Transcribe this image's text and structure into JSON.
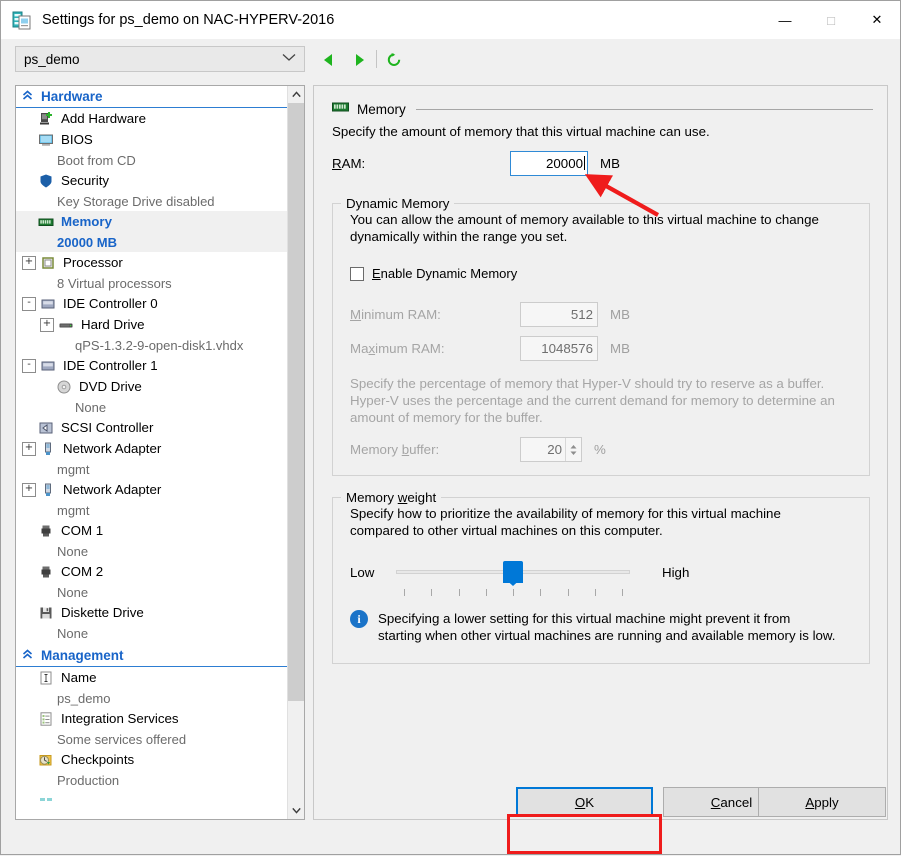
{
  "window": {
    "title": "Settings for ps_demo on NAC-HYPERV-2016",
    "icon": "vm-settings-icon",
    "minimize": "—",
    "maximize": "□",
    "close": "✕"
  },
  "toolbar": {
    "vm_selected": "ps_demo",
    "chevron": "⌄",
    "back_icon": "back-triangle-icon",
    "forward_icon": "forward-triangle-icon",
    "refresh_icon": "refresh-icon",
    "accent_green": "#1eb41e"
  },
  "sidebar": {
    "groups": [
      {
        "label": "Hardware",
        "caret": "«",
        "items": [
          {
            "label": "Add Hardware",
            "sub": "",
            "expander": "",
            "icon": "add-hardware-icon",
            "selected": false
          },
          {
            "label": "BIOS",
            "sub": "Boot from CD",
            "expander": "",
            "icon": "bios-monitor-icon",
            "selected": false
          },
          {
            "label": "Security",
            "sub": "Key Storage Drive disabled",
            "expander": "",
            "icon": "security-shield-icon",
            "selected": false
          },
          {
            "label": "Memory",
            "sub": "20000 MB",
            "expander": "",
            "icon": "memory-dimm-icon",
            "selected": true
          },
          {
            "label": "Processor",
            "sub": "8 Virtual processors",
            "expander": "+",
            "icon": "processor-chip-icon",
            "selected": false
          },
          {
            "label": "IDE Controller 0",
            "sub": "",
            "expander": "-",
            "icon": "ide-controller-icon",
            "selected": false
          },
          {
            "label": "Hard Drive",
            "sub": "qPS-1.3.2-9-open-disk1.vhdx",
            "expander": "+",
            "icon": "hard-drive-icon",
            "selected": false,
            "indent": 1
          },
          {
            "label": "IDE Controller 1",
            "sub": "",
            "expander": "-",
            "icon": "ide-controller-icon",
            "selected": false
          },
          {
            "label": "DVD Drive",
            "sub": "None",
            "expander": "",
            "icon": "dvd-drive-icon",
            "selected": false,
            "indent": 1
          },
          {
            "label": "SCSI Controller",
            "sub": "",
            "expander": "",
            "icon": "scsi-controller-icon",
            "selected": false
          },
          {
            "label": "Network Adapter",
            "sub": "mgmt",
            "expander": "+",
            "icon": "network-adapter-icon",
            "selected": false
          },
          {
            "label": "Network Adapter",
            "sub": "mgmt",
            "expander": "+",
            "icon": "network-adapter-icon",
            "selected": false
          },
          {
            "label": "COM 1",
            "sub": "None",
            "expander": "",
            "icon": "com-port-icon",
            "selected": false
          },
          {
            "label": "COM 2",
            "sub": "None",
            "expander": "",
            "icon": "com-port-icon",
            "selected": false
          },
          {
            "label": "Diskette Drive",
            "sub": "None",
            "expander": "",
            "icon": "diskette-drive-icon",
            "selected": false
          }
        ]
      },
      {
        "label": "Management",
        "caret": "«",
        "items": [
          {
            "label": "Name",
            "sub": "ps_demo",
            "expander": "",
            "icon": "name-textfield-icon",
            "selected": false
          },
          {
            "label": "Integration Services",
            "sub": "Some services offered",
            "expander": "",
            "icon": "integration-services-icon",
            "selected": false
          },
          {
            "label": "Checkpoints",
            "sub": "Production",
            "expander": "",
            "icon": "checkpoints-icon",
            "selected": false
          }
        ]
      }
    ],
    "scroll_up": "˄",
    "scroll_down": "˅"
  },
  "main": {
    "section_title": "Memory",
    "section_icon": "memory-dimm-icon",
    "description": "Specify the amount of memory that this virtual machine can use.",
    "ram": {
      "label": "RAM:",
      "label_accel": "R",
      "value": "20000",
      "unit": "MB"
    },
    "dynamic_memory": {
      "legend": "Dynamic Memory",
      "paragraph_line1": "You can allow the amount of memory available to this virtual machine to change",
      "paragraph_line2": "dynamically within the range you set.",
      "enable_checkbox": {
        "label": "Enable Dynamic Memory",
        "checked": false
      },
      "minimum_ram": {
        "label": "Minimum RAM:",
        "value": "512",
        "unit": "MB"
      },
      "maximum_ram": {
        "label": "Maximum RAM:",
        "value": "1048576",
        "unit": "MB"
      },
      "buffer_paragraph_line1": "Specify the percentage of memory that Hyper-V should try to reserve as a buffer.",
      "buffer_paragraph_line2": "Hyper-V uses the percentage and the current demand for memory to determine an",
      "buffer_paragraph_line3": "amount of memory for the buffer.",
      "memory_buffer": {
        "label": "Memory buffer:",
        "value": "20",
        "unit": "%"
      }
    },
    "memory_weight": {
      "legend": "Memory weight",
      "paragraph_line1": "Specify how to prioritize the availability of memory for this virtual machine",
      "paragraph_line2": "compared to other virtual machines on this computer.",
      "slider": {
        "low_label": "Low",
        "high_label": "High",
        "position": 5,
        "ticks": 9,
        "min": 1,
        "max": 9,
        "accent": "#0078d7"
      },
      "info_icon": "info-icon",
      "info_line1": "Specifying a lower setting for this virtual machine might prevent it from",
      "info_line2": "starting when other virtual machines are running and available memory is low."
    }
  },
  "footer": {
    "ok": "OK",
    "cancel": "Cancel",
    "apply": "Apply"
  },
  "annotations": {
    "arrow_color": "#ef1c1c",
    "highlight_color": "#ef1c1c"
  }
}
